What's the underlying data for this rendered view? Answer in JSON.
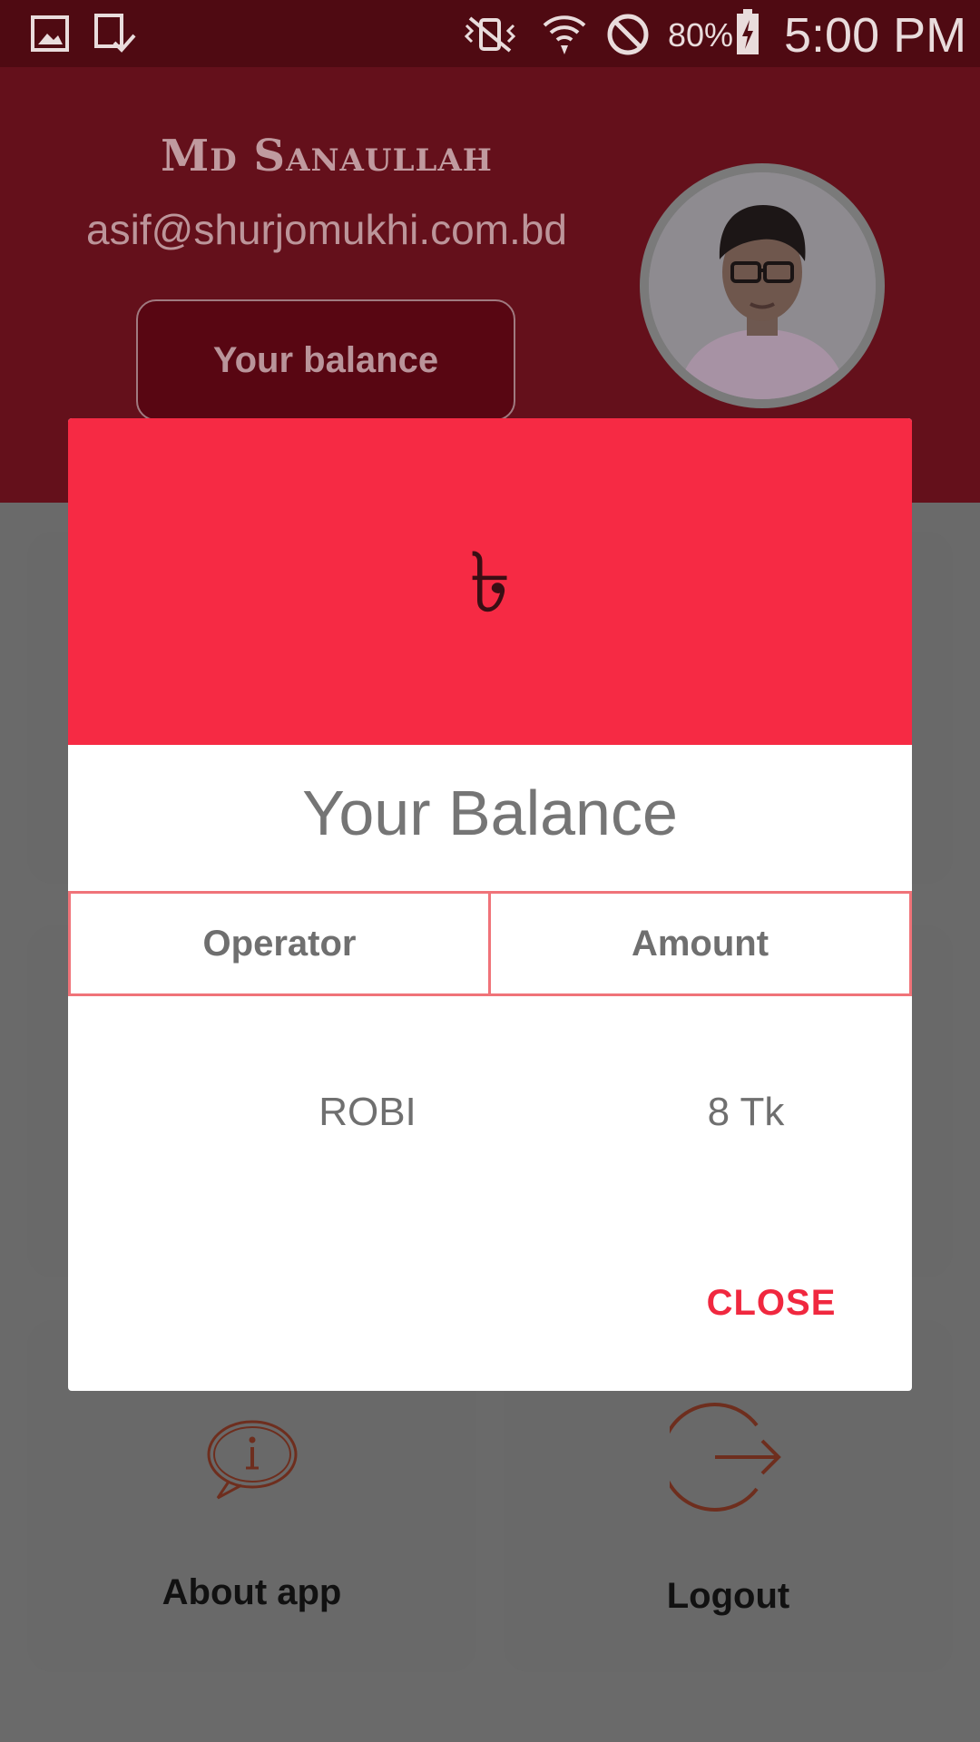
{
  "status_bar": {
    "battery": "80%",
    "time": "5:00 PM"
  },
  "profile": {
    "name": "Md Sanaullah",
    "email": "asif@shurjomukhi.com.bd",
    "balance_button": "Your balance"
  },
  "cards": [
    {
      "label": "About app",
      "icon": "info-bubble-icon"
    },
    {
      "label": "Logout",
      "icon": "logout-icon"
    }
  ],
  "dialog": {
    "symbol": "৳",
    "title": "Your Balance",
    "columns": [
      "Operator",
      "Amount"
    ],
    "rows": [
      {
        "operator": "ROBI",
        "amount": "8 Tk"
      }
    ],
    "close_label": "CLOSE"
  },
  "colors": {
    "banner": "#f62a44",
    "accent": "#f0283f",
    "header": "#64101b"
  }
}
